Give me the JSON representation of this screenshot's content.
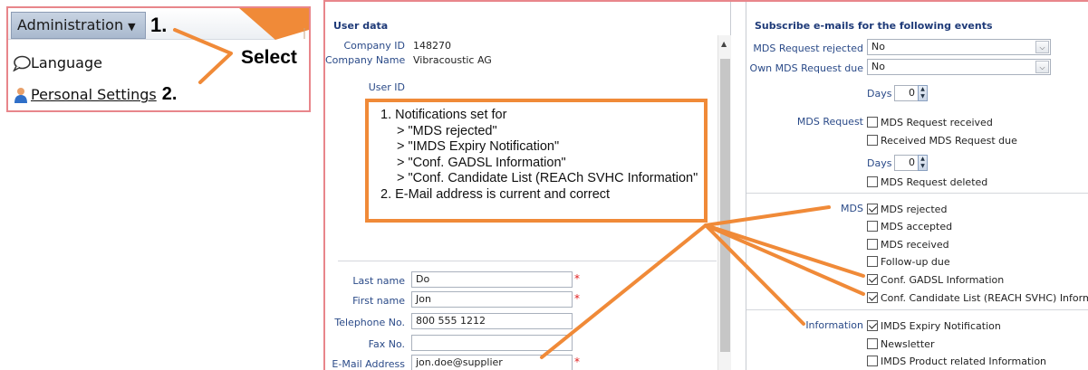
{
  "menu": {
    "admin_label": "Administration",
    "step1": "1.",
    "language_label": "Language",
    "personal_settings_label": "Personal Settings",
    "step2": "2.",
    "select_label": "Select"
  },
  "user_data": {
    "title": "User data",
    "company_id_label": "Company ID",
    "company_id": "148270",
    "company_name_label": "Company Name",
    "company_name": "Vibracoustic AG",
    "user_id_label": "User ID",
    "last_name_label": "Last name",
    "last_name": "Do",
    "first_name_label": "First name",
    "first_name": "Jon",
    "telephone_label": "Telephone No.",
    "telephone": "800 555 1212",
    "fax_label": "Fax No.",
    "fax": "",
    "email_label": "E-Mail Address",
    "email": "jon.doe@supplier",
    "required_mark": "*"
  },
  "note": {
    "line1": "1. Notifications set for",
    "line2": "> \"MDS rejected\"",
    "line3": "> \"IMDS Expiry Notification\"",
    "line4": "> \"Conf. GADSL Information\"",
    "line5": "> \"Conf. Candidate List (REACh SVHC Information\"",
    "line6": "2. E-Mail address is current and correct"
  },
  "subscribe": {
    "title": "Subscribe e-mails for the following events",
    "mds_request_rejected_label": "MDS Request rejected",
    "mds_request_rejected_value": "No",
    "own_mds_request_due_label": "Own MDS Request due",
    "own_mds_request_due_value": "No",
    "days_label": "Days",
    "days_value_1": "0",
    "days_value_2": "0",
    "mds_request_group": "MDS Request",
    "mds_request_received": "MDS Request received",
    "received_mds_request_due": "Received MDS Request due",
    "mds_request_deleted": "MDS Request deleted",
    "mds_group": "MDS",
    "mds_rejected": "MDS rejected",
    "mds_accepted": "MDS accepted",
    "mds_received": "MDS received",
    "follow_up_due": "Follow-up due",
    "conf_gadsl": "Conf. GADSL Information",
    "conf_candidate": "Conf. Candidate List (REACH SVHC) Information",
    "information_group": "Information",
    "imds_expiry": "IMDS Expiry Notification",
    "newsletter": "Newsletter",
    "imds_product": "IMDS Product related Information"
  },
  "colors": {
    "accent_orange": "#f08a38",
    "frame_pink": "#e8868b",
    "title_blue": "#1e3a78",
    "label_blue": "#2a4a88",
    "required_red": "#e02020"
  },
  "icons": {
    "language": "speech-bubble-icon",
    "personal_settings": "person-icon",
    "dropdown": "chevron-down-icon",
    "spinner": "spinner-arrows-icon",
    "checkbox_checked": "checkmark-icon"
  }
}
